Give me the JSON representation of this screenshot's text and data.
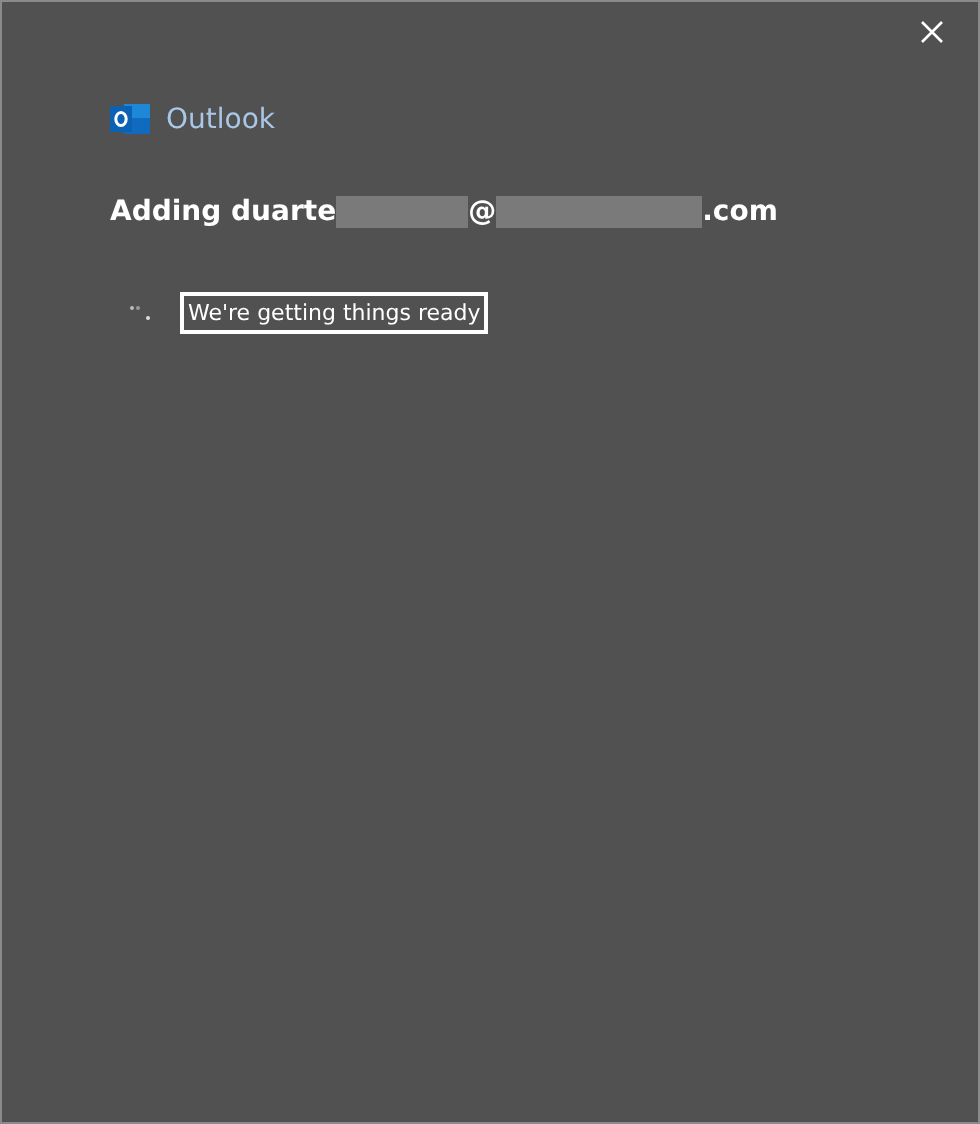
{
  "app": {
    "name": "Outlook"
  },
  "heading": {
    "prefix": "Adding duarte",
    "at": "@",
    "suffix": ".com"
  },
  "status": {
    "text": "We're getting things ready",
    "focused": true
  }
}
